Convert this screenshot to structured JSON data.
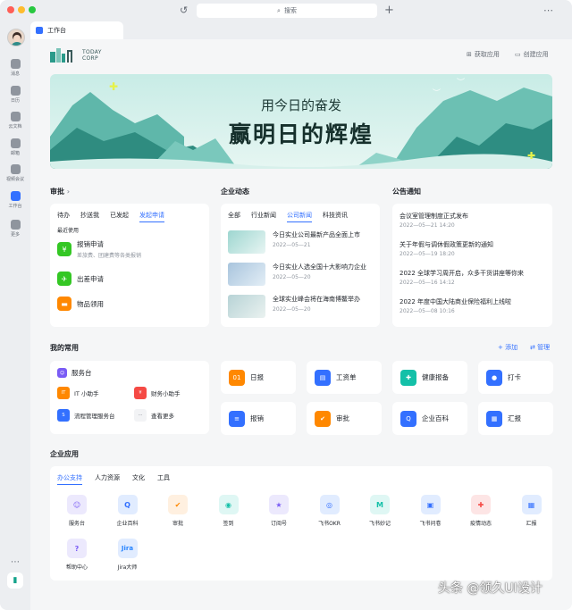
{
  "search": {
    "label": "搜索"
  },
  "sidebar": {
    "items": [
      {
        "label": "消息",
        "color": "#8f959e"
      },
      {
        "label": "日历",
        "color": "#8f959e"
      },
      {
        "label": "云文档",
        "color": "#8f959e"
      },
      {
        "label": "邮箱",
        "color": "#8f959e"
      },
      {
        "label": "视频会议",
        "color": "#8f959e"
      },
      {
        "label": "工作台",
        "color": "#3370ff"
      },
      {
        "label": "更多",
        "color": "#8f959e"
      }
    ]
  },
  "tab": {
    "label": "工作台"
  },
  "header": {
    "logo_line1": "TODAY",
    "logo_line2": "CORP",
    "get_app": "获取应用",
    "create_app": "创建应用"
  },
  "banner": {
    "subtitle": "用今日的奋发",
    "title": "赢明日的辉煌"
  },
  "approval": {
    "title": "审批",
    "tabs": [
      "待办",
      "抄送我",
      "已发起",
      "发起申请"
    ],
    "active_tab": 3,
    "recent_label": "最近使用",
    "items": [
      {
        "name": "报销申请",
        "desc": "差旅费、团建费等各类报销",
        "color": "#34c724"
      },
      {
        "name": "出差申请",
        "desc": "",
        "color": "#34c724"
      },
      {
        "name": "物品领用",
        "desc": "",
        "color": "#ff8800"
      }
    ]
  },
  "news": {
    "title": "企业动态",
    "tabs": [
      "全部",
      "行业新闻",
      "公司新闻",
      "科技资讯"
    ],
    "active_tab": 2,
    "items": [
      {
        "title": "今日实业公司最新产品全面上市",
        "date": "2022—05—21"
      },
      {
        "title": "今日实业人选全国十大影响力企业",
        "date": "2022—05—20"
      },
      {
        "title": "全球实业峰会将在海南博鳌举办",
        "date": "2022—05—20"
      }
    ]
  },
  "announcements": {
    "title": "公告通知",
    "items": [
      {
        "title": "会议室管理制度正式发布",
        "time": "2022—05—21 14:20"
      },
      {
        "title": "关于年假与调休假政策更新的通知",
        "time": "2022—05—19 18:20"
      },
      {
        "title": "2022 全球学习周开启，众多干货讲座等你来",
        "time": "2022—05—16  14:12"
      },
      {
        "title": "2022 年度中国大陆商业保险福利上线啦",
        "time": "2022—05—08 10:16"
      }
    ]
  },
  "favorites": {
    "title": "我的常用",
    "add": "添加",
    "manage": "管理",
    "service_desk": {
      "title": "服务台",
      "items": [
        {
          "label": "IT 小助手",
          "icon_text": "IT",
          "color": "#ff8800"
        },
        {
          "label": "财务小助手",
          "icon_text": "¥",
          "color": "#f54a45"
        },
        {
          "label": "流程管理服务台",
          "icon_text": "S",
          "color": "#3370ff"
        },
        {
          "label": "查看更多",
          "icon_text": "···",
          "color": "#f2f3f5"
        }
      ]
    },
    "tiles": [
      {
        "label": "日报",
        "icon_text": "01",
        "color": "#ff8800"
      },
      {
        "label": "工资单",
        "icon_text": "▤",
        "color": "#3370ff"
      },
      {
        "label": "健康报备",
        "icon_text": "✚",
        "color": "#14c0a8"
      },
      {
        "label": "打卡",
        "icon_text": "●",
        "color": "#3370ff"
      },
      {
        "label": "报销",
        "icon_text": "≡",
        "color": "#3370ff"
      },
      {
        "label": "审批",
        "icon_text": "✔",
        "color": "#ff8800"
      },
      {
        "label": "企业百科",
        "icon_text": "Q",
        "color": "#3370ff"
      },
      {
        "label": "汇报",
        "icon_text": "▦",
        "color": "#3370ff"
      }
    ]
  },
  "enterprise_apps": {
    "title": "企业应用",
    "tabs": [
      "办公支持",
      "人力资源",
      "文化",
      "工具"
    ],
    "active_tab": 0,
    "apps": [
      {
        "label": "服务台",
        "icon_text": "☺",
        "bg": "#ece9fd",
        "fg": "#7a5cf5"
      },
      {
        "label": "企业百科",
        "icon_text": "Q",
        "bg": "#e1ecff",
        "fg": "#3370ff"
      },
      {
        "label": "审批",
        "icon_text": "✔",
        "bg": "#fff0e0",
        "fg": "#ff8800"
      },
      {
        "label": "签到",
        "icon_text": "◉",
        "bg": "#dff7f4",
        "fg": "#14c0a8"
      },
      {
        "label": "订阅号",
        "icon_text": "★",
        "bg": "#ece9fd",
        "fg": "#7a5cf5"
      },
      {
        "label": "飞书OKR",
        "icon_text": "◎",
        "bg": "#e1ecff",
        "fg": "#3370ff"
      },
      {
        "label": "飞书妙记",
        "icon_text": "M",
        "bg": "#dff7f4",
        "fg": "#14c0a8"
      },
      {
        "label": "飞书问卷",
        "icon_text": "▣",
        "bg": "#e1ecff",
        "fg": "#3370ff"
      },
      {
        "label": "疫情动态",
        "icon_text": "✚",
        "bg": "#fde5e5",
        "fg": "#f54a45"
      },
      {
        "label": "汇报",
        "icon_text": "▦",
        "bg": "#e1ecff",
        "fg": "#3370ff"
      },
      {
        "label": "帮助中心",
        "icon_text": "?",
        "bg": "#ece9fd",
        "fg": "#7a5cf5"
      },
      {
        "label": "Jira大师",
        "icon_text": "Jira",
        "bg": "#e1ecff",
        "fg": "#2684ff"
      }
    ]
  },
  "watermark": "头条 @领久UI设计",
  "accent": "#3370ff"
}
